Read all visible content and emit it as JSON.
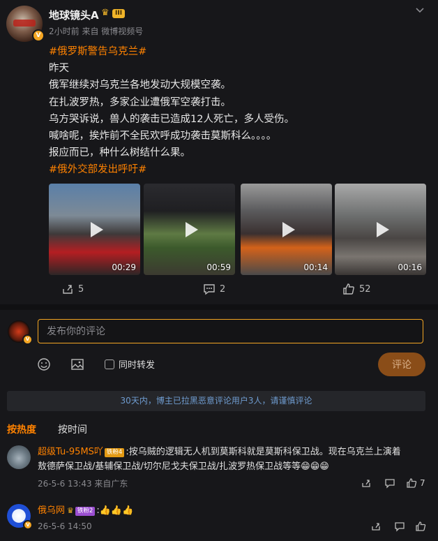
{
  "post": {
    "author": "地球镜头A",
    "level_badge": "III",
    "meta": "2小时前  来自 微博视频号",
    "lines": [
      {
        "text": "#俄罗斯警告乌克兰#",
        "hashtag": true
      },
      {
        "text": "昨天",
        "hashtag": false
      },
      {
        "text": "俄军继续对乌克兰各地发动大规模空袭。",
        "hashtag": false
      },
      {
        "text": "在扎波罗热，多家企业遭俄军空袭打击。",
        "hashtag": false
      },
      {
        "text": "乌方哭诉说，兽人的袭击已造成12人死亡，多人受伤。",
        "hashtag": false
      },
      {
        "text": "喊啥呢，挨炸前不全民欢呼成功袭击莫斯科么。。。。",
        "hashtag": false
      },
      {
        "text": "报应而已，种什么树结什么果。",
        "hashtag": false
      },
      {
        "text": "#俄外交部发出呼吁#",
        "hashtag": true
      }
    ],
    "videos": [
      {
        "duration": "00:29"
      },
      {
        "duration": "00:59"
      },
      {
        "duration": "00:14"
      },
      {
        "duration": "00:16"
      }
    ],
    "actions": {
      "reposts": "5",
      "comments": "2",
      "likes": "52"
    }
  },
  "composer": {
    "placeholder": "发布你的评论",
    "repost_label": "同时转发",
    "submit_label": "评论"
  },
  "notice": "30天内，博主已拉黑恶意评论用户3人，请谨慎评论",
  "sort": {
    "hot": "按热度",
    "time": "按时间"
  },
  "comments": [
    {
      "name": "超级Tu-95MS吖",
      "badge": "铁粉4",
      "line1": ":按乌贼的逻辑无人机到莫斯科就是莫斯科保卫战。现在乌克兰上演着",
      "line2": "敖德萨保卫战/基辅保卫战/切尔尼戈夫保卫战/扎波罗热保卫战等等",
      "emojis": "😁😁😁",
      "meta": "26-5-6 13:43  来自广东",
      "likes": "7"
    },
    {
      "name": "俄乌网",
      "badge": "铁粉2",
      "line1": ":👍👍👍",
      "meta": "26-5-6 14:50"
    }
  ],
  "colors": {
    "accent": "#ff8200",
    "link": "#6f9cd0",
    "background": "#17171a"
  }
}
